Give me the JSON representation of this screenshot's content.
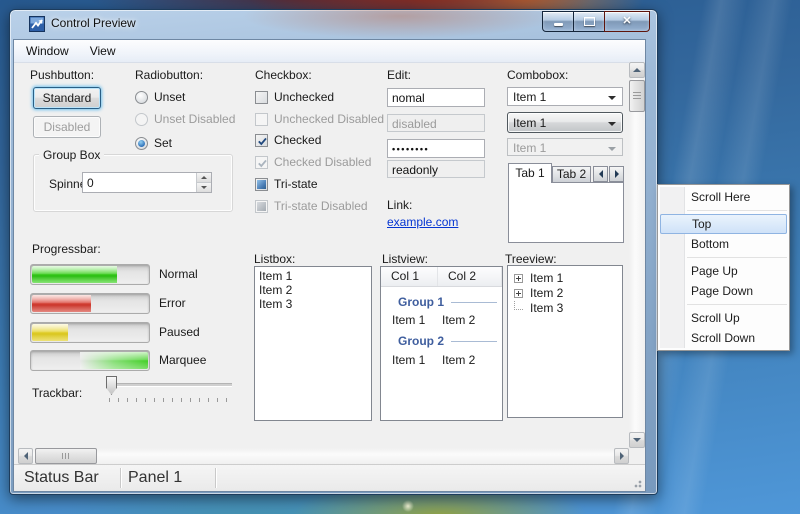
{
  "window": {
    "title": "Control Preview",
    "menu": {
      "items": [
        {
          "label": "Window"
        },
        {
          "label": "View"
        }
      ]
    },
    "window_buttons": {
      "minimize": "minimize",
      "maximize": "maximize",
      "close": "close"
    },
    "status_bar": {
      "panels": [
        {
          "text": "Status Bar"
        },
        {
          "text": "Panel 1"
        },
        {
          "text": ""
        }
      ]
    }
  },
  "panels": {
    "pushbutton": {
      "heading": "Pushbutton:",
      "standard": "Standard",
      "disabled": "Disabled"
    },
    "radiobutton": {
      "heading": "Radiobutton:",
      "options": [
        {
          "label": "Unset",
          "state": "unchecked"
        },
        {
          "label": "Unset Disabled",
          "state": "disabled"
        },
        {
          "label": "Set",
          "state": "checked"
        }
      ]
    },
    "checkbox": {
      "heading": "Checkbox:",
      "options": [
        {
          "label": "Unchecked",
          "state": "unchecked"
        },
        {
          "label": "Unchecked Disabled",
          "state": "unchecked-disabled"
        },
        {
          "label": "Checked",
          "state": "checked"
        },
        {
          "label": "Checked Disabled",
          "state": "checked-disabled"
        },
        {
          "label": "Tri-state",
          "state": "indeterminate"
        },
        {
          "label": "Tri-state Disabled",
          "state": "indeterminate-disabled"
        }
      ]
    },
    "edit": {
      "heading": "Edit:",
      "normal_value": "nomal",
      "disabled_value": "disabled",
      "password_value": "••••••••",
      "readonly_value": "readonly"
    },
    "link": {
      "heading": "Link:",
      "text": "example.com",
      "color": "#0535d2"
    },
    "combobox": {
      "heading": "Combobox:",
      "normal_value": "Item 1",
      "button_value": "Item 1",
      "disabled_value": "Item 1"
    },
    "tabs": {
      "tab1": "Tab 1",
      "tab2": "Tab 2",
      "active": "Tab 1"
    },
    "groupbox": {
      "heading": "Group Box",
      "spinner_label": "Spinner:",
      "spinner_value": "0"
    },
    "progressbar": {
      "heading": "Progressbar:",
      "bars": [
        {
          "label": "Normal",
          "percent": 72,
          "color": "#2fbf12"
        },
        {
          "label": "Error",
          "percent": 50,
          "color": "#d23a2e"
        },
        {
          "label": "Paused",
          "percent": 30,
          "color": "#ddc92a"
        },
        {
          "label": "Marquee",
          "percent": null,
          "color": "#4ed133"
        }
      ]
    },
    "trackbar": {
      "heading": "Trackbar:",
      "thumb_position": "left"
    },
    "listbox": {
      "heading": "Listbox:",
      "items": [
        "Item 1",
        "Item 2",
        "Item 3"
      ]
    },
    "listview": {
      "heading": "Listview:",
      "columns": [
        "Col 1",
        "Col 2"
      ],
      "groups": [
        {
          "name": "Group 1",
          "row": [
            "Item 1",
            "Item 2"
          ]
        },
        {
          "name": "Group 2",
          "row": [
            "Item 1",
            "Item 2"
          ]
        }
      ]
    },
    "treeview": {
      "heading": "Treeview:",
      "items": [
        "Item 1",
        "Item 2",
        "Item 3"
      ]
    }
  },
  "context_menu": {
    "items": [
      "Scroll Here",
      "Top",
      "Bottom",
      "Page Up",
      "Page Down",
      "Scroll Up",
      "Scroll Down"
    ],
    "highlighted": "Top",
    "highlight_color": "#cfe2f8"
  }
}
